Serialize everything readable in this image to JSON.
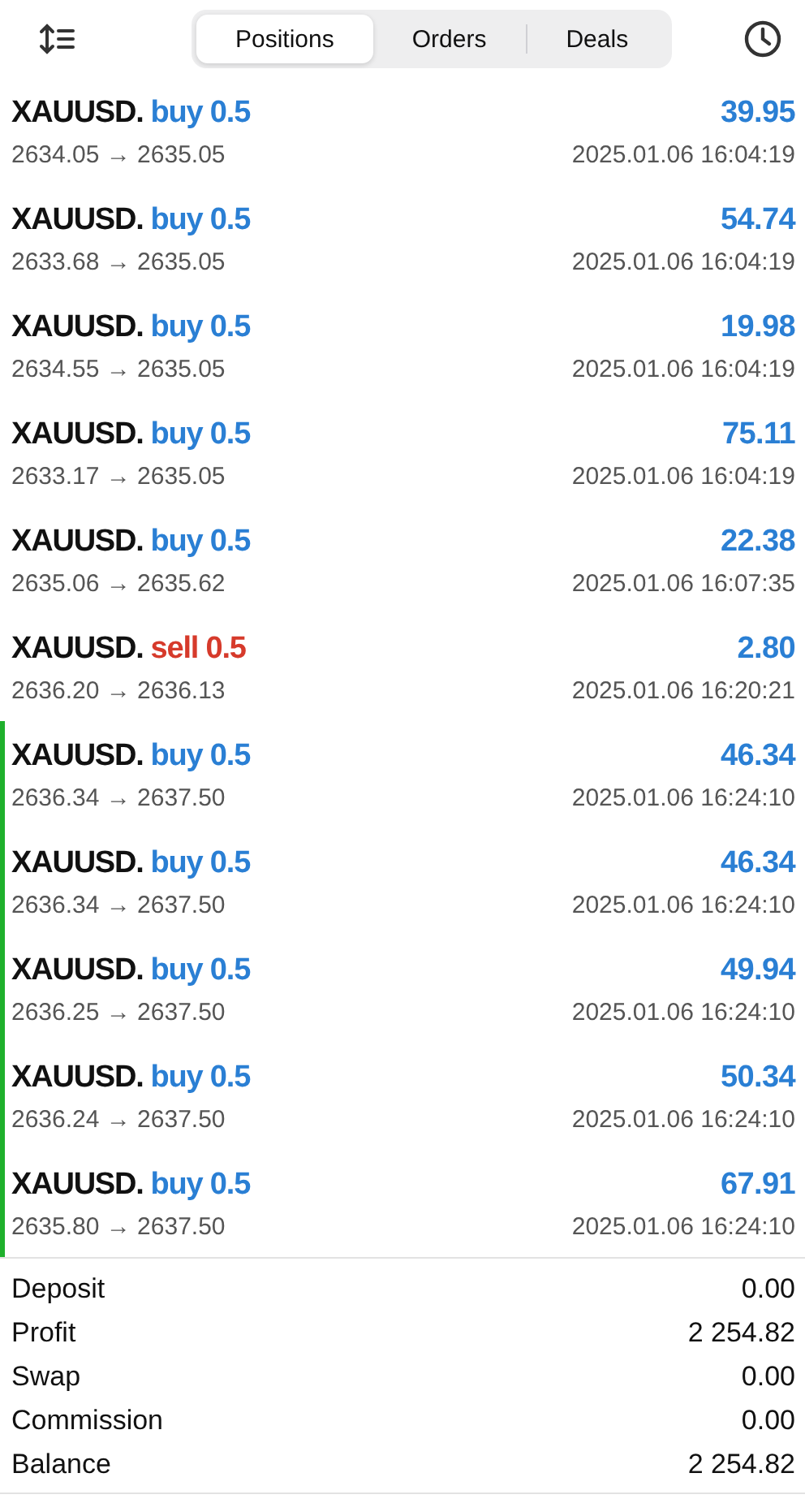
{
  "tabs": [
    {
      "label": "Positions",
      "selected": true
    },
    {
      "label": "Orders",
      "selected": false
    },
    {
      "label": "Deals",
      "selected": false
    }
  ],
  "deals": [
    {
      "symbol": "XAUUSD.",
      "kind": "buy",
      "order": "buy 0.5",
      "prices": "2634.05 → 2635.05",
      "profit": "39.95",
      "time": "2025.01.06 16:04:19",
      "marked": false
    },
    {
      "symbol": "XAUUSD.",
      "kind": "buy",
      "order": "buy 0.5",
      "prices": "2633.68 → 2635.05",
      "profit": "54.74",
      "time": "2025.01.06 16:04:19",
      "marked": false
    },
    {
      "symbol": "XAUUSD.",
      "kind": "buy",
      "order": "buy 0.5",
      "prices": "2634.55 → 2635.05",
      "profit": "19.98",
      "time": "2025.01.06 16:04:19",
      "marked": false
    },
    {
      "symbol": "XAUUSD.",
      "kind": "buy",
      "order": "buy 0.5",
      "prices": "2633.17 → 2635.05",
      "profit": "75.11",
      "time": "2025.01.06 16:04:19",
      "marked": false
    },
    {
      "symbol": "XAUUSD.",
      "kind": "buy",
      "order": "buy 0.5",
      "prices": "2635.06 → 2635.62",
      "profit": "22.38",
      "time": "2025.01.06 16:07:35",
      "marked": false
    },
    {
      "symbol": "XAUUSD.",
      "kind": "sell",
      "order": "sell 0.5",
      "prices": "2636.20 → 2636.13",
      "profit": "2.80",
      "time": "2025.01.06 16:20:21",
      "marked": false
    },
    {
      "symbol": "XAUUSD.",
      "kind": "buy",
      "order": "buy 0.5",
      "prices": "2636.34 → 2637.50",
      "profit": "46.34",
      "time": "2025.01.06 16:24:10",
      "marked": true
    },
    {
      "symbol": "XAUUSD.",
      "kind": "buy",
      "order": "buy 0.5",
      "prices": "2636.34 → 2637.50",
      "profit": "46.34",
      "time": "2025.01.06 16:24:10",
      "marked": true
    },
    {
      "symbol": "XAUUSD.",
      "kind": "buy",
      "order": "buy 0.5",
      "prices": "2636.25 → 2637.50",
      "profit": "49.94",
      "time": "2025.01.06 16:24:10",
      "marked": true
    },
    {
      "symbol": "XAUUSD.",
      "kind": "buy",
      "order": "buy 0.5",
      "prices": "2636.24 → 2637.50",
      "profit": "50.34",
      "time": "2025.01.06 16:24:10",
      "marked": true
    },
    {
      "symbol": "XAUUSD.",
      "kind": "buy",
      "order": "buy 0.5",
      "prices": "2635.80 → 2637.50",
      "profit": "67.91",
      "time": "2025.01.06 16:24:10",
      "marked": true
    }
  ],
  "summary": [
    {
      "label": "Deposit",
      "value": "0.00"
    },
    {
      "label": "Profit",
      "value": "2 254.82"
    },
    {
      "label": "Swap",
      "value": "0.00"
    },
    {
      "label": "Commission",
      "value": "0.00"
    },
    {
      "label": "Balance",
      "value": "2 254.82"
    }
  ]
}
